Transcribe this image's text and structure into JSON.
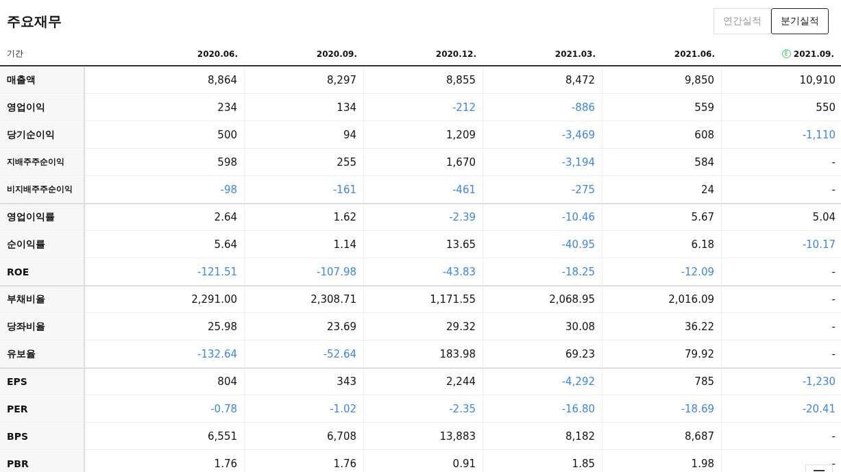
{
  "title": "주요재무",
  "period_toggle": [
    {
      "label": "연간실적",
      "selected": false
    },
    {
      "label": "분기실적",
      "selected": true
    }
  ],
  "table": {
    "corner": "기간",
    "columns": [
      {
        "label": "2020.06.",
        "estimate": false
      },
      {
        "label": "2020.09.",
        "estimate": false
      },
      {
        "label": "2020.12.",
        "estimate": false
      },
      {
        "label": "2021.03.",
        "estimate": false
      },
      {
        "label": "2021.06.",
        "estimate": false
      },
      {
        "label": "2021.09.",
        "estimate": true,
        "estimate_mark": "E"
      }
    ],
    "rows": [
      {
        "label": "매출액",
        "kind": "main",
        "divider_above": false,
        "cells": [
          {
            "value": "8,864",
            "negative": false
          },
          {
            "value": "8,297",
            "negative": false
          },
          {
            "value": "8,855",
            "negative": false
          },
          {
            "value": "8,472",
            "negative": false
          },
          {
            "value": "9,850",
            "negative": false
          },
          {
            "value": "10,910",
            "negative": false
          }
        ]
      },
      {
        "label": "영업이익",
        "kind": "main",
        "divider_above": false,
        "cells": [
          {
            "value": "234",
            "negative": false
          },
          {
            "value": "134",
            "negative": false
          },
          {
            "value": "-212",
            "negative": true
          },
          {
            "value": "-886",
            "negative": true
          },
          {
            "value": "559",
            "negative": false
          },
          {
            "value": "550",
            "negative": false
          }
        ]
      },
      {
        "label": "당기순이익",
        "kind": "main",
        "divider_above": false,
        "cells": [
          {
            "value": "500",
            "negative": false
          },
          {
            "value": "94",
            "negative": false
          },
          {
            "value": "1,209",
            "negative": false
          },
          {
            "value": "-3,469",
            "negative": true
          },
          {
            "value": "608",
            "negative": false
          },
          {
            "value": "-1,110",
            "negative": true
          }
        ]
      },
      {
        "label": "지배주주순이익",
        "kind": "sub",
        "divider_above": false,
        "cells": [
          {
            "value": "598",
            "negative": false
          },
          {
            "value": "255",
            "negative": false
          },
          {
            "value": "1,670",
            "negative": false
          },
          {
            "value": "-3,194",
            "negative": true
          },
          {
            "value": "584",
            "negative": false
          },
          {
            "value": "-",
            "negative": false
          }
        ]
      },
      {
        "label": "비지배주주순이익",
        "kind": "sub",
        "divider_above": false,
        "cells": [
          {
            "value": "-98",
            "negative": true
          },
          {
            "value": "-161",
            "negative": true
          },
          {
            "value": "-461",
            "negative": true
          },
          {
            "value": "-275",
            "negative": true
          },
          {
            "value": "24",
            "negative": false
          },
          {
            "value": "-",
            "negative": false
          }
        ]
      },
      {
        "label": "영업이익률",
        "kind": "main",
        "divider_above": true,
        "cells": [
          {
            "value": "2.64",
            "negative": false
          },
          {
            "value": "1.62",
            "negative": false
          },
          {
            "value": "-2.39",
            "negative": true
          },
          {
            "value": "-10.46",
            "negative": true
          },
          {
            "value": "5.67",
            "negative": false
          },
          {
            "value": "5.04",
            "negative": false
          }
        ]
      },
      {
        "label": "순이익률",
        "kind": "main",
        "divider_above": false,
        "cells": [
          {
            "value": "5.64",
            "negative": false
          },
          {
            "value": "1.14",
            "negative": false
          },
          {
            "value": "13.65",
            "negative": false
          },
          {
            "value": "-40.95",
            "negative": true
          },
          {
            "value": "6.18",
            "negative": false
          },
          {
            "value": "-10.17",
            "negative": true
          }
        ]
      },
      {
        "label": "ROE",
        "kind": "main",
        "divider_above": false,
        "cells": [
          {
            "value": "-121.51",
            "negative": true
          },
          {
            "value": "-107.98",
            "negative": true
          },
          {
            "value": "-43.83",
            "negative": true
          },
          {
            "value": "-18.25",
            "negative": true
          },
          {
            "value": "-12.09",
            "negative": true
          },
          {
            "value": "-",
            "negative": false
          }
        ]
      },
      {
        "label": "부채비율",
        "kind": "main",
        "divider_above": true,
        "cells": [
          {
            "value": "2,291.00",
            "negative": false
          },
          {
            "value": "2,308.71",
            "negative": false
          },
          {
            "value": "1,171.55",
            "negative": false
          },
          {
            "value": "2,068.95",
            "negative": false
          },
          {
            "value": "2,016.09",
            "negative": false
          },
          {
            "value": "-",
            "negative": false
          }
        ]
      },
      {
        "label": "당좌비율",
        "kind": "main",
        "divider_above": false,
        "cells": [
          {
            "value": "25.98",
            "negative": false
          },
          {
            "value": "23.69",
            "negative": false
          },
          {
            "value": "29.32",
            "negative": false
          },
          {
            "value": "30.08",
            "negative": false
          },
          {
            "value": "36.22",
            "negative": false
          },
          {
            "value": "-",
            "negative": false
          }
        ]
      },
      {
        "label": "유보율",
        "kind": "main",
        "divider_above": false,
        "cells": [
          {
            "value": "-132.64",
            "negative": true
          },
          {
            "value": "-52.64",
            "negative": true
          },
          {
            "value": "183.98",
            "negative": false
          },
          {
            "value": "69.23",
            "negative": false
          },
          {
            "value": "79.92",
            "negative": false
          },
          {
            "value": "-",
            "negative": false
          }
        ]
      },
      {
        "label": "EPS",
        "kind": "main",
        "divider_above": true,
        "cells": [
          {
            "value": "804",
            "negative": false
          },
          {
            "value": "343",
            "negative": false
          },
          {
            "value": "2,244",
            "negative": false
          },
          {
            "value": "-4,292",
            "negative": true
          },
          {
            "value": "785",
            "negative": false
          },
          {
            "value": "-1,230",
            "negative": true
          }
        ]
      },
      {
        "label": "PER",
        "kind": "main",
        "divider_above": false,
        "cells": [
          {
            "value": "-0.78",
            "negative": true
          },
          {
            "value": "-1.02",
            "negative": true
          },
          {
            "value": "-2.35",
            "negative": true
          },
          {
            "value": "-16.80",
            "negative": true
          },
          {
            "value": "-18.69",
            "negative": true
          },
          {
            "value": "-20.41",
            "negative": true
          }
        ]
      },
      {
        "label": "BPS",
        "kind": "main",
        "divider_above": false,
        "cells": [
          {
            "value": "6,551",
            "negative": false
          },
          {
            "value": "6,708",
            "negative": false
          },
          {
            "value": "13,883",
            "negative": false
          },
          {
            "value": "8,182",
            "negative": false
          },
          {
            "value": "8,687",
            "negative": false
          },
          {
            "value": "-",
            "negative": false
          }
        ]
      },
      {
        "label": "PBR",
        "kind": "main",
        "divider_above": false,
        "cells": [
          {
            "value": "1.76",
            "negative": false
          },
          {
            "value": "1.76",
            "negative": false
          },
          {
            "value": "0.91",
            "negative": false
          },
          {
            "value": "1.85",
            "negative": false
          },
          {
            "value": "1.98",
            "negative": false
          },
          {
            "value": "-",
            "negative": false
          }
        ]
      }
    ]
  }
}
